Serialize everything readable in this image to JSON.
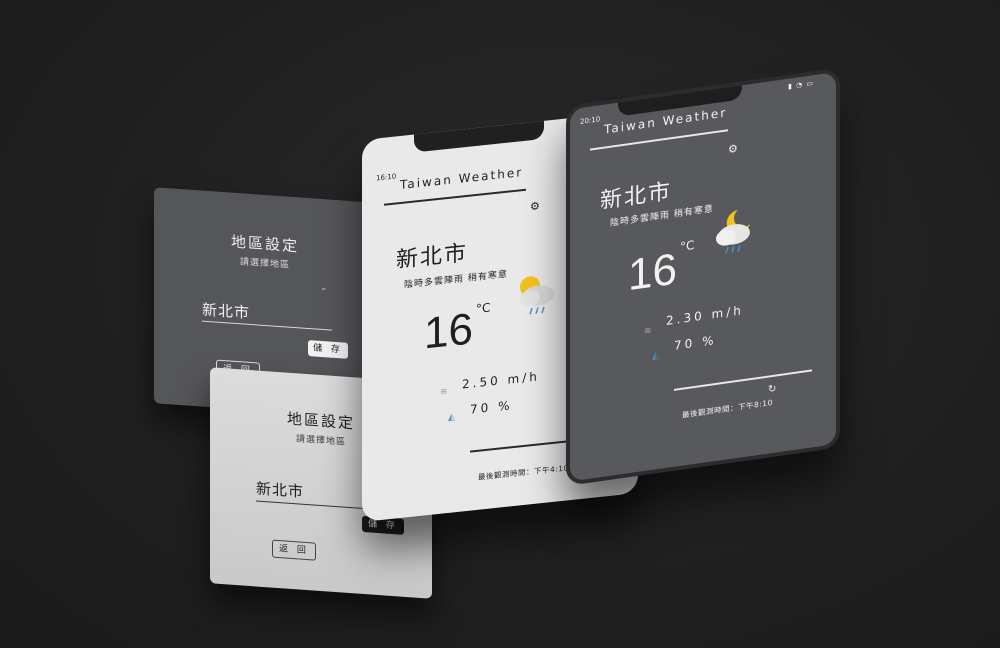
{
  "settings": {
    "title": "地區設定",
    "subtitle": "請選擇地區",
    "city": "新北市",
    "save_label": "儲 存",
    "back_label": "返 回"
  },
  "app": {
    "title": "Taiwan Weather",
    "city": "新北市",
    "description": "陰時多雲陣雨  稍有寒意",
    "unit": "°C"
  },
  "phone_light": {
    "status_time": "16:10",
    "temperature": "16",
    "wind": "2.50 m/h",
    "humidity": "70 %",
    "last_observed": "最後觀測時間：下午4:10"
  },
  "phone_dark": {
    "status_time": "20:10",
    "temperature": "16",
    "wind": "2.30 m/h",
    "humidity": "70 %",
    "last_observed": "最後觀測時間：下午8:10"
  },
  "icons": {
    "gear": "gear-icon",
    "refresh": "refresh-icon",
    "wind": "wind-icon",
    "humidity": "humidity-icon",
    "weather_day": "sun-cloud-rain-icon",
    "weather_night": "moon-cloud-rain-icon",
    "dropdown": "chevron-down-icon"
  },
  "colors": {
    "background": "#1f1f1f",
    "card_dark": "#55565a",
    "card_light": "#d2d2d2",
    "sun": "#f2c21b",
    "accent_blue": "#4a90c8"
  }
}
